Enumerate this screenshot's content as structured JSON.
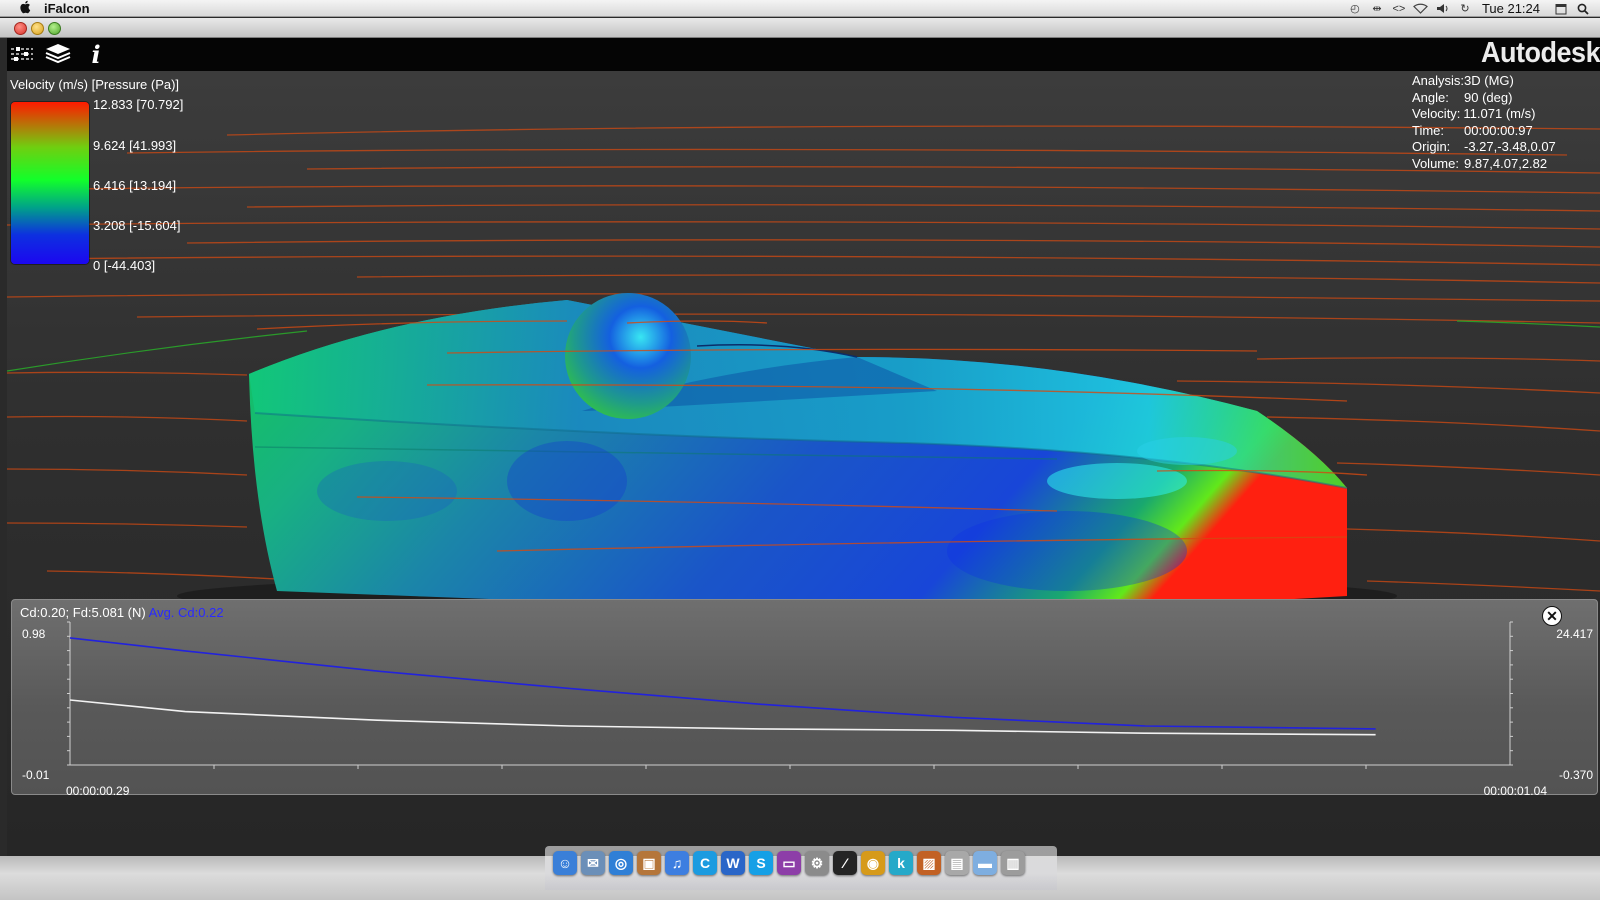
{
  "menubar": {
    "app_name": "iFalcon",
    "clock": "Tue 21:24"
  },
  "toolbar": {
    "brand": "Autodesk",
    "icons": [
      "settings-sliders-icon",
      "layers-icon",
      "info-icon"
    ],
    "info_glyph": "i"
  },
  "legend": {
    "title": "Velocity (m/s) [Pressure (Pa)]",
    "ticks": [
      "12.833 [70.792]",
      "9.624 [41.993]",
      "6.416 [13.194]",
      "3.208 [-15.604]",
      "0 [-44.403]"
    ],
    "colors": [
      "#ff1a00",
      "#12ff2a",
      "#1c07f0"
    ]
  },
  "analysis": {
    "rows": [
      {
        "key": "Analysis:",
        "value": "3D (MG)"
      },
      {
        "key": "Angle:",
        "value": "90 (deg)"
      },
      {
        "key": "Velocity:",
        "value": "11.071 (m/s)"
      },
      {
        "key": "Time:",
        "value": "00:00:00.97"
      },
      {
        "key": "Origin:",
        "value": "-3.27,-3.48,0.07"
      },
      {
        "key": "Volume:",
        "value": "9.87,4.07,2.82"
      }
    ]
  },
  "chart_panel": {
    "close_glyph": "✕",
    "readout": "Cd:0.20; Fd:5.081 (N)",
    "avg": "Avg. Cd:0.22",
    "left_axis": {
      "max": "0.98",
      "min": "-0.01"
    },
    "right_axis": {
      "max": "24.417",
      "min": "-0.370"
    },
    "x_start": "00:00:00.29",
    "x_end": "00:00:01.04"
  },
  "chart_data": {
    "type": "line",
    "xlabel": "",
    "ylabel": "",
    "xlim": [
      "00:00:00.29",
      "00:00:01.04"
    ],
    "ylim": [
      -0.01,
      0.98
    ],
    "y2lim": [
      -0.37,
      24.417
    ],
    "x": [
      0.29,
      0.35,
      0.45,
      0.55,
      0.65,
      0.75,
      0.85,
      0.97
    ],
    "series": [
      {
        "color": "#2222dd",
        "axis": "left",
        "values": [
          0.87,
          0.78,
          0.64,
          0.52,
          0.41,
          0.32,
          0.26,
          0.24
        ]
      },
      {
        "color": "#f2f2f2",
        "axis": "left",
        "values": [
          0.44,
          0.36,
          0.3,
          0.26,
          0.24,
          0.23,
          0.21,
          0.2
        ]
      }
    ],
    "grid": false
  },
  "dock": {
    "items": [
      {
        "name": "finder-icon",
        "color": "#3a7fd8",
        "glyph": "☺"
      },
      {
        "name": "mail-icon",
        "color": "#6b8fb8",
        "glyph": "✉"
      },
      {
        "name": "safari-icon",
        "color": "#2f7fd6",
        "glyph": "◎"
      },
      {
        "name": "photos-icon",
        "color": "#b5763a",
        "glyph": "▣"
      },
      {
        "name": "itunes-icon",
        "color": "#3d7ee0",
        "glyph": "♫"
      },
      {
        "name": "app-c-icon",
        "color": "#1b9be0",
        "glyph": "C"
      },
      {
        "name": "app-w-icon",
        "color": "#2a66c8",
        "glyph": "W"
      },
      {
        "name": "skype-icon",
        "color": "#15a0e6",
        "glyph": "S"
      },
      {
        "name": "display-icon",
        "color": "#8d3ea8",
        "glyph": "▭"
      },
      {
        "name": "preferences-icon",
        "color": "#8b8b8b",
        "glyph": "⚙"
      },
      {
        "name": "graph-app-icon",
        "color": "#242424",
        "glyph": "⁄"
      },
      {
        "name": "lion-app-icon",
        "color": "#d69a1a",
        "glyph": "◉"
      },
      {
        "name": "app-k-icon",
        "color": "#25a9c9",
        "glyph": "k"
      },
      {
        "name": "image-app-icon",
        "color": "#c26124",
        "glyph": "▨"
      },
      {
        "name": "preview-icon",
        "color": "#a8a8a8",
        "glyph": "▤"
      },
      {
        "name": "folder-icon",
        "color": "#7eaee0",
        "glyph": "▬"
      },
      {
        "name": "trash-icon",
        "color": "#9c9c9c",
        "glyph": "▥"
      }
    ]
  }
}
